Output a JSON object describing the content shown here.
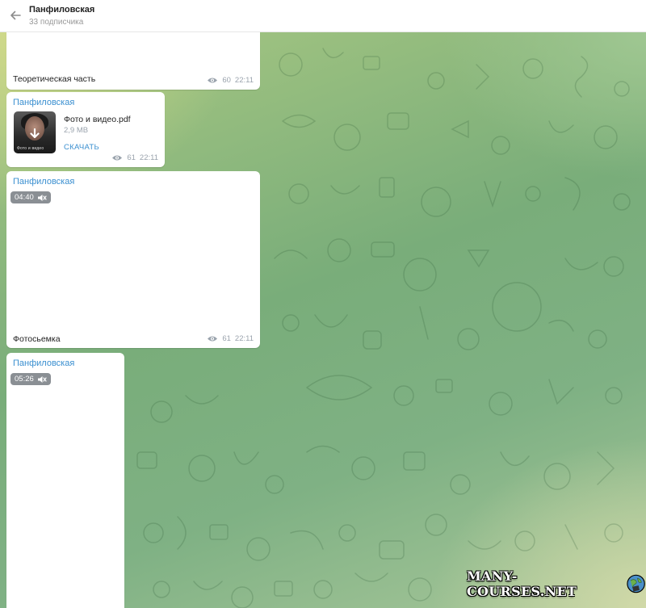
{
  "header": {
    "title": "Панфиловская",
    "subtitle": "33 подписчика"
  },
  "messages": [
    {
      "caption": "Теоретическая часть",
      "views": "60",
      "time": "22:11"
    },
    {
      "sender": "Панфиловская",
      "file_name": "Фото и видео.pdf",
      "file_size": "2,9 MB",
      "download_label": "СКАЧАТЬ",
      "thumb_text": "Фото и видео",
      "views": "61",
      "time": "22:11"
    },
    {
      "sender": "Панфиловская",
      "duration": "04:40",
      "caption": "Фотосьемка",
      "views": "61",
      "time": "22:11"
    },
    {
      "sender": "Панфиловская",
      "duration": "05:26"
    }
  ],
  "watermark": {
    "text": "MANY-COURSES.NET"
  },
  "colors": {
    "accent": "#3a8fd0",
    "meta": "#9aa3ad",
    "badge": "#8a8f94"
  }
}
